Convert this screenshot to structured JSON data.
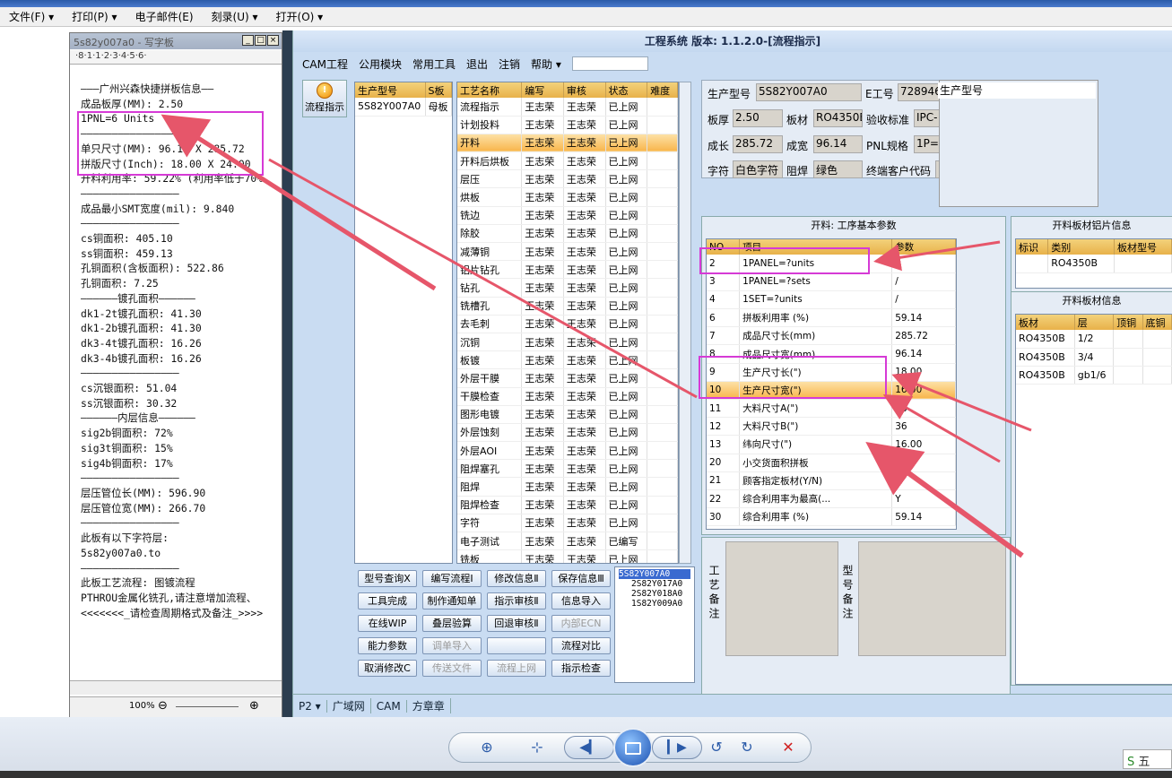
{
  "viewer": {
    "menu": [
      {
        "label": "文件(F)",
        "chevron": "▾"
      },
      {
        "label": "打印(P)",
        "chevron": "▾"
      },
      {
        "label": "电子邮件(E)",
        "chevron": ""
      },
      {
        "label": "刻录(U)",
        "chevron": "▾"
      },
      {
        "label": "打开(O)",
        "chevron": "▾"
      }
    ],
    "zoom": "100%"
  },
  "wordpad": {
    "title": "5s82y007a0 - 写字板",
    "ruler": "·8·1·1·2·3·4·5·6·",
    "lines": [
      "———广州兴森快捷拼板信息——",
      "成品板厚(MM): 2.50",
      "1PNL=6 Units",
      "————————————————",
      "单只尺寸(MM): 96.14 X 285.72",
      "拼版尺寸(Inch): 18.00 X 24.00",
      "开料利用率: 59.22% (利用率低于70%",
      "————————————————",
      "成品最小SMT宽度(mil): 9.840",
      "————————————————",
      "cs铜面积: 405.10",
      "ss铜面积: 459.13",
      "孔铜面积(含板面积): 522.86",
      "孔铜面积: 7.25",
      "——————镀孔面积——————",
      "dk1-2t镀孔面积: 41.30",
      "dk1-2b镀孔面积: 41.30",
      "dk3-4t镀孔面积: 16.26",
      "dk3-4b镀孔面积: 16.26",
      "",
      "————————————————",
      "cs沉银面积: 51.04",
      "ss沉银面积: 30.32",
      "——————内层信息——————",
      "sig2b铜面积: 72%",
      "sig3t铜面积: 15%",
      "sig4b铜面积: 17%",
      "————————————————",
      "层压管位长(MM): 596.90",
      "层压管位宽(MM): 266.70",
      "————————————————",
      "此板有以下字符层:",
      "5s82y007a0.to",
      "————————————————",
      "此板工艺流程: 图镀流程",
      "PTHROU金属化铣孔,请注意增加流程、",
      "<<<<<<<_请检查周期格式及备注_>>>>"
    ]
  },
  "cam": {
    "title": "工程系统  版本: 1.1.2.0-[流程指示]",
    "menu": [
      "CAM工程",
      "公用模块",
      "常用工具",
      "退出",
      "注销",
      "帮助 ▾"
    ],
    "flow_button": "流程指示",
    "model_grid": {
      "headers": [
        "生产型号",
        "S板"
      ],
      "rows": [
        [
          "5S82Y007A0",
          "母板"
        ]
      ]
    },
    "process_grid": {
      "headers": [
        "工艺名称",
        "编写",
        "审核",
        "状态",
        "难度"
      ],
      "selected_index": 2,
      "rows": [
        [
          "流程指示",
          "王志荣",
          "王志荣",
          "已上网",
          ""
        ],
        [
          "计划投料",
          "王志荣",
          "王志荣",
          "已上网",
          ""
        ],
        [
          "开料",
          "王志荣",
          "王志荣",
          "已上网",
          ""
        ],
        [
          "开料后烘板",
          "王志荣",
          "王志荣",
          "已上网",
          ""
        ],
        [
          "层压",
          "王志荣",
          "王志荣",
          "已上网",
          ""
        ],
        [
          "烘板",
          "王志荣",
          "王志荣",
          "已上网",
          ""
        ],
        [
          "铣边",
          "王志荣",
          "王志荣",
          "已上网",
          ""
        ],
        [
          "除胶",
          "王志荣",
          "王志荣",
          "已上网",
          ""
        ],
        [
          "减薄铜",
          "王志荣",
          "王志荣",
          "已上网",
          ""
        ],
        [
          "铝片钻孔",
          "王志荣",
          "王志荣",
          "已上网",
          ""
        ],
        [
          "钻孔",
          "王志荣",
          "王志荣",
          "已上网",
          ""
        ],
        [
          "铣槽孔",
          "王志荣",
          "王志荣",
          "已上网",
          ""
        ],
        [
          "去毛刺",
          "王志荣",
          "王志荣",
          "已上网",
          ""
        ],
        [
          "沉铜",
          "王志荣",
          "王志荣",
          "已上网",
          ""
        ],
        [
          "板镀",
          "王志荣",
          "王志荣",
          "已上网",
          ""
        ],
        [
          "外层干膜",
          "王志荣",
          "王志荣",
          "已上网",
          ""
        ],
        [
          "干膜检查",
          "王志荣",
          "王志荣",
          "已上网",
          ""
        ],
        [
          "图形电镀",
          "王志荣",
          "王志荣",
          "已上网",
          ""
        ],
        [
          "外层蚀刻",
          "王志荣",
          "王志荣",
          "已上网",
          ""
        ],
        [
          "外层AOI",
          "王志荣",
          "王志荣",
          "已上网",
          ""
        ],
        [
          "阻焊塞孔",
          "王志荣",
          "王志荣",
          "已上网",
          ""
        ],
        [
          "阻焊",
          "王志荣",
          "王志荣",
          "已上网",
          ""
        ],
        [
          "阻焊检查",
          "王志荣",
          "王志荣",
          "已上网",
          ""
        ],
        [
          "字符",
          "王志荣",
          "王志荣",
          "已上网",
          ""
        ],
        [
          "电子测试",
          "王志荣",
          "王志荣",
          "已编写",
          ""
        ],
        [
          "铣板",
          "王志荣",
          "王志荣",
          "已上网",
          ""
        ]
      ]
    },
    "buttons": [
      [
        "型号查询Ⅹ",
        "编写流程Ⅰ",
        "修改信息Ⅱ",
        "保存信息Ⅲ"
      ],
      [
        "工具完成",
        "制作通知单",
        "指示审核Ⅱ",
        "信息导入"
      ],
      [
        "在线WIP",
        "叠层验算",
        "回退审核Ⅱ",
        "内部ECN"
      ],
      [
        "能力参数",
        "调单导入",
        "",
        "流程对比"
      ],
      [
        "取消修改Ⅽ",
        "传送文件",
        "流程上网",
        "指示检查"
      ]
    ],
    "disabled_buttons": [
      "内部ECN",
      "调单导入",
      "传送文件",
      "流程上网"
    ],
    "tree": [
      "5S82Y007A0",
      "2S82Y017A0",
      "2S82Y018A0",
      "1S82Y009A0"
    ],
    "info": {
      "model_label": "生产型号",
      "model_value": "5S82Y007A0",
      "eng_label": "E工号",
      "eng_value": "728946",
      "model2_label": "生产型号",
      "thickness_label": "板厚",
      "thickness_value": "2.50",
      "material_label": "板材",
      "material_value": "RO4350B",
      "standard_label": "验收标准",
      "standard_value": "IPC-",
      "length_label": "成长",
      "length_value": "285.72",
      "width_label": "成宽",
      "width_value": "96.14",
      "pnl_label": "PNL规格",
      "pnl_value": "1P=",
      "legend_label": "字符",
      "legend_value": "白色字符",
      "mask_label": "阻焊",
      "mask_value": "绿色",
      "customer_label": "终端客户代码",
      "customer_value": ""
    },
    "params": {
      "title": "开料: 工序基本参数",
      "headers": [
        "NO",
        "项目",
        "参数"
      ],
      "rows": [
        [
          "2",
          "1PANEL=?units",
          "4"
        ],
        [
          "3",
          "1PANEL=?sets",
          "/"
        ],
        [
          "4",
          "1SET=?units",
          "/"
        ],
        [
          "6",
          "拼板利用率 (%)",
          "59.14"
        ],
        [
          "7",
          "成品尺寸长(mm)",
          "285.72"
        ],
        [
          "8",
          "成品尺寸宽(mm)",
          "96.14"
        ],
        [
          "9",
          "生产尺寸长(\")",
          "18.00"
        ],
        [
          "10",
          "生产尺寸宽(\")",
          "16.00"
        ],
        [
          "11",
          "大料尺寸A(\")",
          "48"
        ],
        [
          "12",
          "大料尺寸B(\")",
          "36"
        ],
        [
          "13",
          "纬向尺寸(\")",
          "16.00"
        ],
        [
          "20",
          "小交货面积拼板",
          "N"
        ],
        [
          "21",
          "顾客指定板材(Y/N)",
          "N"
        ],
        [
          "22",
          "综合利用率为最高(...",
          "Y"
        ],
        [
          "30",
          "综合利用率 (%)",
          "59.14"
        ]
      ],
      "selected_index": 7
    },
    "remarks": {
      "process": "工艺备注",
      "model": "型号备注"
    },
    "foil": {
      "title": "开料板材铝片信息",
      "headers": [
        "标识",
        "类别",
        "板材型号"
      ],
      "rows": [
        [
          "",
          "RO4350B",
          ""
        ]
      ]
    },
    "board": {
      "title": "开料板材信息",
      "headers": [
        "板材",
        "层",
        "顶铜",
        "底铜"
      ],
      "rows": [
        [
          "RO4350B",
          "1/2",
          "",
          ""
        ],
        [
          "RO4350B",
          "3/4",
          "",
          ""
        ],
        [
          "RO4350B",
          "gb1/6",
          "",
          ""
        ]
      ]
    },
    "status": [
      "P2 ▾",
      "广域网",
      "CAM",
      "方章章"
    ]
  },
  "ime": "五"
}
